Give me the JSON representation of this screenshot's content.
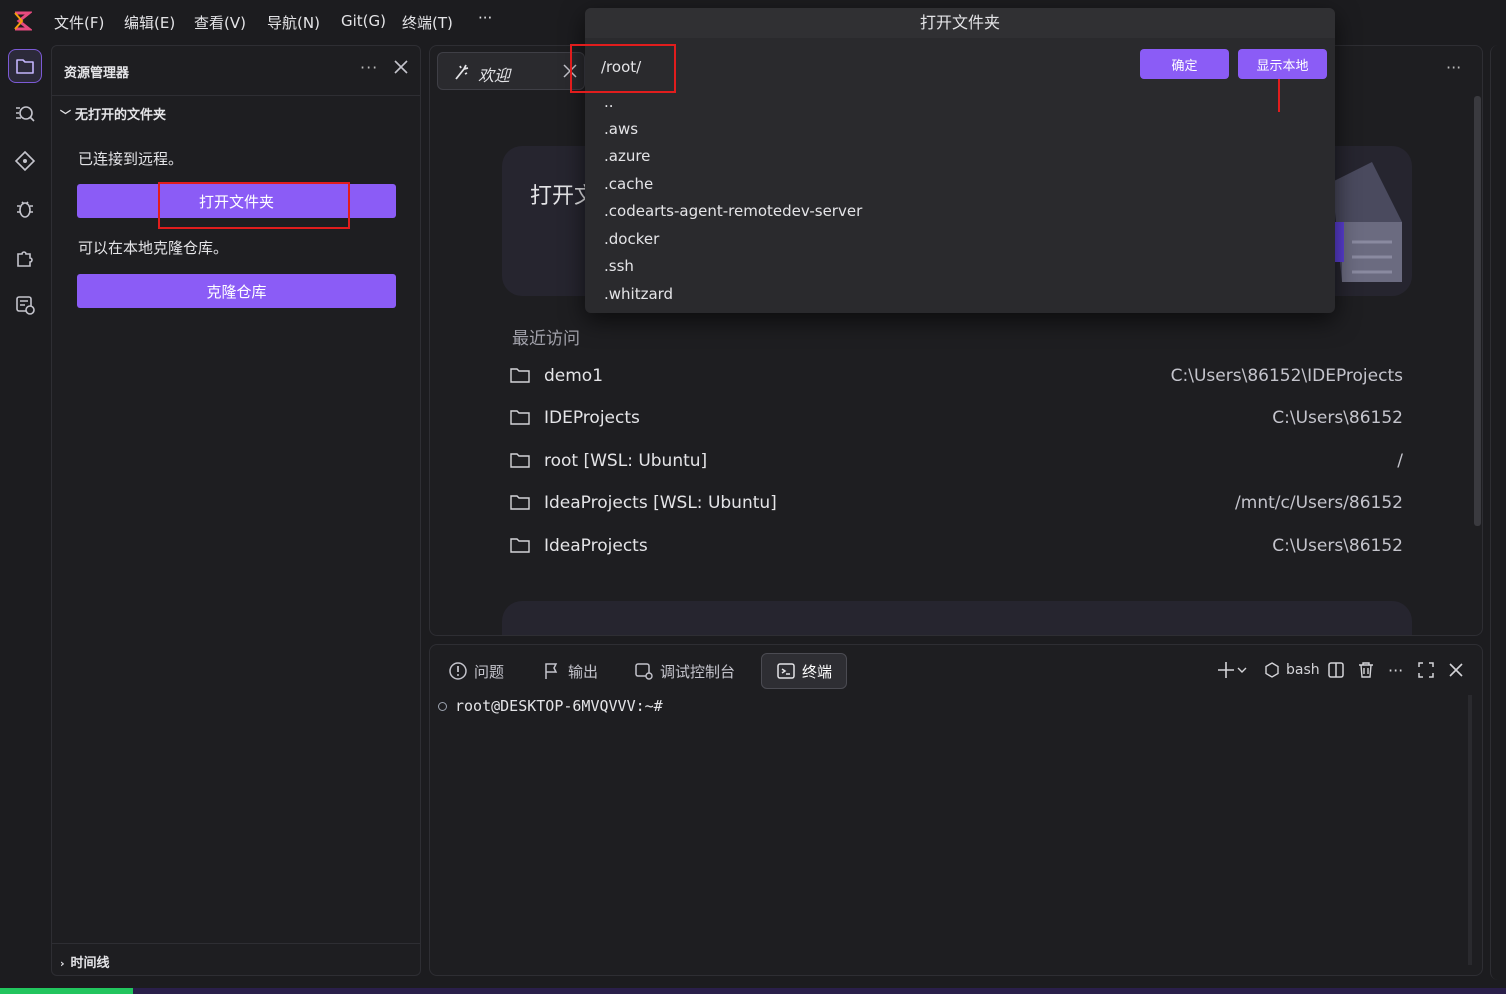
{
  "menubar": {
    "items": [
      "文件(F)",
      "编辑(E)",
      "查看(V)",
      "导航(N)",
      "Git(G)",
      "终端(T)",
      "···"
    ]
  },
  "activity": {
    "icons": [
      "explorer-icon",
      "search-icon",
      "source-control-icon",
      "debug-icon",
      "extensions-icon",
      "remote-explorer-icon"
    ]
  },
  "sidebar": {
    "title": "资源管理器",
    "more": "···",
    "section": "无打开的文件夹",
    "connected_text": "已连接到远程。",
    "open_folder_label": "打开文件夹",
    "clone_text": "可以在本地克隆仓库。",
    "clone_label": "克隆仓库",
    "timeline": "时间线"
  },
  "editor": {
    "tab_label": "欢迎",
    "more": "···",
    "card_title": "打开文",
    "recent_title": "最近访问",
    "recent": [
      {
        "name": "demo1",
        "path": "C:\\Users\\86152\\IDEProjects"
      },
      {
        "name": "IDEProjects",
        "path": "C:\\Users\\86152"
      },
      {
        "name": "root [WSL: Ubuntu]",
        "path": "/"
      },
      {
        "name": "IdeaProjects [WSL: Ubuntu]",
        "path": "/mnt/c/Users/86152"
      },
      {
        "name": "IdeaProjects",
        "path": "C:\\Users\\86152"
      }
    ]
  },
  "panel": {
    "tabs": [
      "问题",
      "输出",
      "调试控制台",
      "终端"
    ],
    "shell": "bash",
    "more": "···",
    "prompt": "root@DESKTOP-6MVQVVV:~#"
  },
  "modal": {
    "title": "打开文件夹",
    "input_value": "/root/",
    "ok_label": "确定",
    "show_local_label": "显示本地",
    "items": [
      "..",
      ".aws",
      ".azure",
      ".cache",
      ".codearts-agent-remotedev-server",
      ".docker",
      ".ssh",
      ".whitzard"
    ]
  },
  "colors": {
    "accent": "#8b5cf6",
    "highlight": "#e11d1d",
    "background": "#1c1c1f"
  }
}
